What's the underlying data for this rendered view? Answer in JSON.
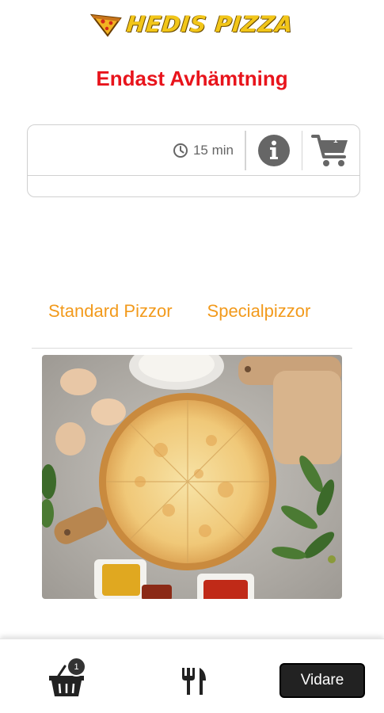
{
  "header": {
    "logo_text": "HEDIS PIZZA",
    "subtitle": "Endast Avhämtning"
  },
  "info_bar": {
    "time": "15 min",
    "cart_count": "1"
  },
  "tabs": [
    {
      "label": "Standard Pizzor"
    },
    {
      "label": "Specialpizzor"
    }
  ],
  "bottom_bar": {
    "basket_count": "1",
    "next_label": "Vidare"
  },
  "colors": {
    "brand_red": "#e8141c",
    "tab_orange": "#f29a1c",
    "logo_yellow": "#f2c619"
  }
}
